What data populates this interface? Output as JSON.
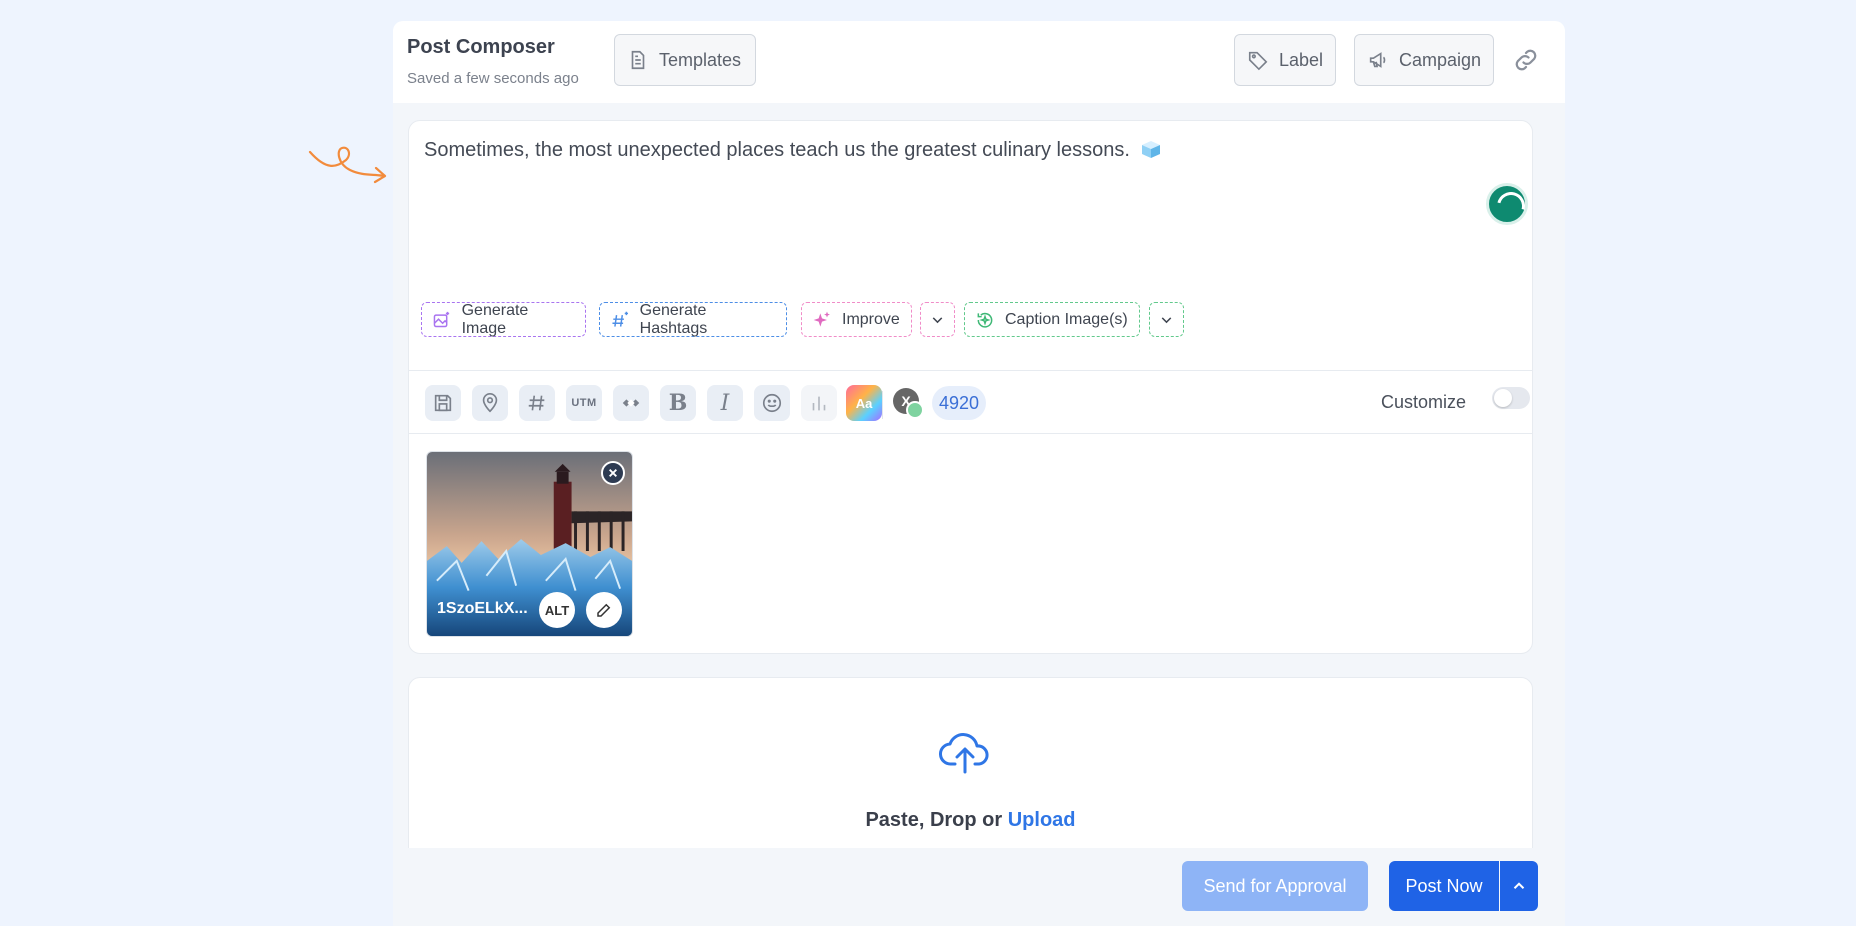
{
  "header": {
    "title": "Post Composer",
    "subtitle": "Saved a few seconds ago",
    "templates_label": "Templates",
    "label_label": "Label",
    "campaign_label": "Campaign"
  },
  "editor": {
    "post_text": "Sometimes, the most unexpected places teach us the greatest culinary lessons."
  },
  "ai_actions": {
    "generate_image": "Generate Image",
    "generate_hashtags": "Generate Hashtags",
    "improve": "Improve",
    "caption_images": "Caption Image(s)"
  },
  "toolbar": {
    "utm_label": "UTM",
    "bold_label": "B",
    "italic_label": "I",
    "font_label": "Aa",
    "account_glyph": "X",
    "char_count": "4920",
    "customize_label": "Customize"
  },
  "media": {
    "file_name": "1SzoELkX...",
    "alt_label": "ALT"
  },
  "upload": {
    "prefix": "Paste, Drop or ",
    "link": "Upload"
  },
  "footer": {
    "approval_label": "Send for Approval",
    "post_label": "Post Now"
  },
  "colors": {
    "primary": "#1f63e6",
    "primary_disabled": "#8eb4f6",
    "accent_orange": "#f28b3c"
  }
}
